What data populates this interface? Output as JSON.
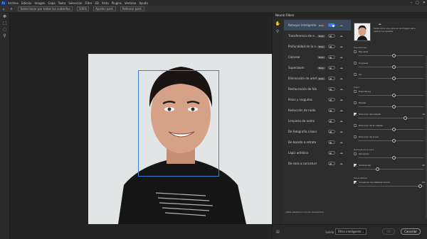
{
  "menubar": {
    "items": [
      "Archivo",
      "Edición",
      "Imagen",
      "Capa",
      "Texto",
      "Selección",
      "Filtro",
      "3D",
      "Vista",
      "Plugins",
      "Ventana",
      "Ayuda"
    ],
    "ps_logo": "Ps",
    "window_controls": [
      "–",
      "□",
      "✕"
    ]
  },
  "optionsbar": {
    "tool_icon": "home-icon",
    "sample_label": "Seleccionar por todas las cubiertas",
    "zoom": "100%",
    "ajustar": "Ajustar pant.",
    "rellenar": "Rellenar pant."
  },
  "dialog": {
    "title": "Neural Filters",
    "filters": [
      {
        "label": "Retoque inteligente",
        "badge": "Beta",
        "enabled": true,
        "selected": true
      },
      {
        "label": "Transferencia de e...",
        "badge": "Beta",
        "enabled": false
      },
      {
        "label": "Profundidad de la n...",
        "badge": "Beta",
        "enabled": false
      },
      {
        "label": "Colorear",
        "badge": "Beta",
        "enabled": false
      },
      {
        "label": "Superzoom",
        "badge": "Beta",
        "enabled": false
      },
      {
        "label": "Eliminación de artef...",
        "badge": "Beta",
        "enabled": false
      },
      {
        "label": "Restauración de fotos",
        "badge": "",
        "enabled": false
      },
      {
        "label": "Polvo y rasguños",
        "badge": "",
        "enabled": false
      },
      {
        "label": "Reducción de ruido",
        "badge": "",
        "enabled": false
      },
      {
        "label": "Limpieza de rostro",
        "badge": "",
        "enabled": false
      },
      {
        "label": "De fotografía a boceto",
        "badge": "",
        "enabled": false
      },
      {
        "label": "De boceto a retrato",
        "badge": "",
        "enabled": false
      },
      {
        "label": "Lápiz artístico",
        "badge": "",
        "enabled": false
      },
      {
        "label": "De cara a caricatura",
        "badge": "",
        "enabled": false
      }
    ],
    "settings": {
      "description": "Selecciona una cara en la imagen para aplicar los ajustes.",
      "sections": [
        {
          "title": "Expresiones",
          "rows": [
            {
              "label": "Felicidad",
              "checked": false,
              "value": "",
              "level": 0.55
            },
            {
              "label": "Sorpresa",
              "checked": false,
              "value": "",
              "level": 0.55
            },
            {
              "label": "Ira",
              "checked": false,
              "value": "",
              "level": 0.55
            }
          ]
        },
        {
          "title": "Edad",
          "rows": [
            {
              "label": "Edad facial",
              "checked": false,
              "value": "",
              "level": 0.55
            },
            {
              "label": "Mirada",
              "checked": false,
              "value": "",
              "level": 0.55
            },
            {
              "label": "Dirección del cabello",
              "checked": true,
              "value": "10",
              "level": 0.72
            },
            {
              "label": "Dirección de la cabeza",
              "checked": false,
              "value": "",
              "level": 0.55
            },
            {
              "label": "Dirección de la luz",
              "checked": false,
              "value": "",
              "level": 0.55
            }
          ]
        },
        {
          "title": "Retoque de la cara",
          "rows": [
            {
              "label": "Ubicación",
              "checked": false,
              "value": "",
              "level": 0.55
            },
            {
              "label": "Iluminación",
              "checked": true,
              "value": "20",
              "level": 0.3
            }
          ]
        },
        {
          "title": "Especialidad",
          "rows": [
            {
              "label": "Conservar los detalles únicos",
              "checked": true,
              "value": "90",
              "level": 0.95
            }
          ]
        }
      ],
      "satisfied_link": "¿Está satisfecho con los resultados?"
    },
    "footer": {
      "output_label": "Salida",
      "output_value": "Filtro inteligente",
      "ok": "OK",
      "cancel": "Cancelar"
    }
  },
  "colors": {
    "accent": "#2a7fff",
    "face_box": "#3a80d8"
  }
}
